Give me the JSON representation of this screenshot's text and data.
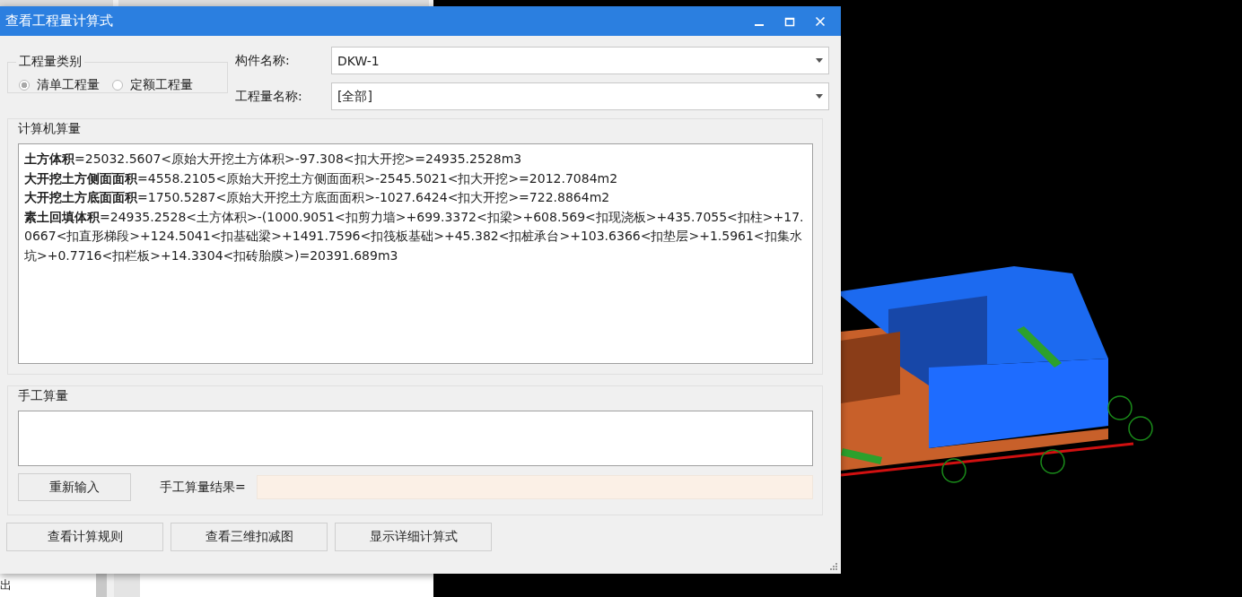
{
  "background_app": {
    "panel_text": "出"
  },
  "dialog": {
    "title": "查看工程量计算式"
  },
  "quantity_type": {
    "label": "工程量类别",
    "options": [
      {
        "label": "清单工程量",
        "selected": true
      },
      {
        "label": "定额工程量",
        "selected": false
      }
    ]
  },
  "fields": [
    {
      "label": "构件名称:",
      "value": "DKW-1"
    },
    {
      "label": "工程量名称:",
      "value": "[全部]"
    }
  ],
  "computed": {
    "label": "计算机算量",
    "lines": [
      "**土方体积**=25032.5607<原始大开挖土方体积>-97.308<扣大开挖>=24935.2528m3",
      "**大开挖土方侧面面积**=4558.2105<原始大开挖土方侧面面积>-2545.5021<扣大开挖>=2012.7084m2",
      "**大开挖土方底面面积**=1750.5287<原始大开挖土方底面面积>-1027.6424<扣大开挖>=722.8864m2",
      "**素土回填体积**=24935.2528<土方体积>-(1000.9051<扣剪力墙>+699.3372<扣梁>+608.569<扣现浇板>+435.7055<扣柱>+17.0667<扣直形梯段>+124.5041<扣基础梁>+1491.7596<扣筏板基础>+45.382<扣桩承台>+103.6366<扣垫层>+1.5961<扣集水坑>+0.7716<扣栏板>+14.3304<扣砖胎膜>)=20391.689m3"
    ]
  },
  "manual": {
    "label": "手工算量",
    "reenter_button": "重新输入",
    "result_label": "手工算量结果="
  },
  "buttons": [
    "查看计算规则",
    "查看三维扣减图",
    "显示详细计算式"
  ]
}
